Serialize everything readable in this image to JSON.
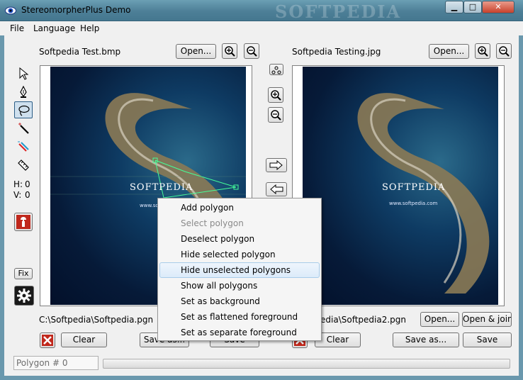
{
  "window": {
    "title": "StereomorpherPlus Demo",
    "watermark": "SOFTPEDIA",
    "controls": {
      "minimize": "▁",
      "maximize": "□",
      "close": "✕"
    }
  },
  "menu": [
    "File",
    "Language",
    "Help"
  ],
  "left_panel": {
    "filename": "Softpedia Test.bmp",
    "open_label": "Open...",
    "path": "C:\\Softpedia\\Softpedia.pgn",
    "clear_label": "Clear",
    "save_as_label": "Save as...",
    "save_label": "Save"
  },
  "right_panel": {
    "filename": "Softpedia Testing.jpg",
    "open_label": "Open...",
    "path": "edia\\Softpedia2.pgn",
    "open2_label": "Open...",
    "open_join_label": "Open & join...",
    "clear_label": "Clear",
    "save_as_label": "Save as...",
    "save_label": "Save"
  },
  "tools": {
    "h_label": "H:",
    "h_value": "0",
    "v_label": "V:",
    "v_value": "0",
    "fix_label": "Fix",
    "icons": [
      "arrow-pointer-icon",
      "pen-icon",
      "lasso-icon",
      "magic-wand-icon",
      "multi-wand-icon",
      "ruler-icon",
      "wrench-icon",
      "gear-icon"
    ]
  },
  "image_text": {
    "left_logo": "SOFTPEDIA",
    "right_logo": "SOFTPEDIA",
    "right_url": "www.softpedia.com",
    "left_url": "www.sof"
  },
  "context_menu": [
    {
      "label": "Add polygon",
      "disabled": false
    },
    {
      "label": "Select polygon",
      "disabled": true
    },
    {
      "label": "Deselect polygon",
      "disabled": false
    },
    {
      "label": "Hide selected polygon",
      "disabled": false
    },
    {
      "label": "Hide unselected polygons",
      "disabled": false,
      "hover": true
    },
    {
      "label": "Show all polygons",
      "disabled": false
    },
    {
      "label": "Set as background",
      "disabled": false
    },
    {
      "label": "Set as flattened foreground",
      "disabled": false
    },
    {
      "label": "Set as separate foreground",
      "disabled": false
    }
  ],
  "status": {
    "polygon": "Polygon # 0",
    "progress": 0
  },
  "colors": {
    "titlebar": "#5a8ca3",
    "accent": "#2b5d86",
    "delete_red": "#c0281c"
  }
}
